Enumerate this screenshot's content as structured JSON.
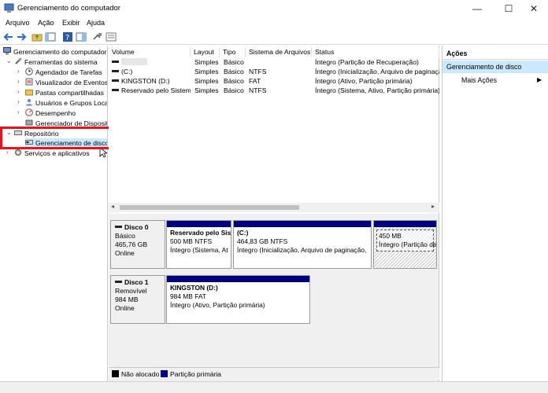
{
  "window": {
    "title": "Gerenciamento do computador",
    "minimize": "—",
    "maximize": "☐",
    "close": "✕"
  },
  "menu": [
    "Arquivo",
    "Ação",
    "Exibir",
    "Ajuda"
  ],
  "tree": {
    "root": "Gerenciamento do computador",
    "system_tools": "Ferramentas do sistema",
    "task_scheduler": "Agendador de Tarefas",
    "event_viewer": "Visualizador de Eventos",
    "shared_folders": "Pastas compartilhadas",
    "users_groups": "Usuários e Grupos Loca",
    "performance": "Desempenho",
    "device_manager": "Gerenciador de Disposit",
    "storage": "Repositório",
    "disk_management": "Gerenciamento de disco",
    "services_apps": "Serviços e aplicativos"
  },
  "columns": [
    "Volume",
    "Layout",
    "Tipo",
    "Sistema de Arquivos",
    "Status"
  ],
  "volumes": [
    {
      "volume": "",
      "layout": "Simples",
      "type": "Básico",
      "fs": "",
      "status": "Íntegro (Partição de Recuperação)"
    },
    {
      "volume": "(C:)",
      "layout": "Simples",
      "type": "Básico",
      "fs": "NTFS",
      "status": "Íntegro (Inicialização, Arquivo de paginaçã"
    },
    {
      "volume": "KINGSTON (D:)",
      "layout": "Simples",
      "type": "Básico",
      "fs": "FAT",
      "status": "Íntegro (Ativo, Partição primária)"
    },
    {
      "volume": "Reservado pelo Sistema",
      "layout": "Simples",
      "type": "Básico",
      "fs": "NTFS",
      "status": "Íntegro (Sistema, Ativo, Partição primária)"
    }
  ],
  "disks": [
    {
      "name": "Disco 0",
      "type": "Básico",
      "size": "465,76 GB",
      "state": "Online",
      "partitions": [
        {
          "title": "Reservado pelo Sis",
          "size": "500 MB NTFS",
          "status": "Íntegro (Sistema, At"
        },
        {
          "title": "(C:)",
          "size": "464,83 GB NTFS",
          "status": "Íntegro (Inicialização, Arquivo de paginação,"
        },
        {
          "title": "",
          "size": "450 MB",
          "status": "Íntegro (Partição de"
        }
      ]
    },
    {
      "name": "Disco 1",
      "type": "Removível",
      "size": "984 MB",
      "state": "Online",
      "partitions": [
        {
          "title": "KINGSTON  (D:)",
          "size": "984 MB FAT",
          "status": "Íntegro (Ativo, Partição primária)"
        }
      ]
    }
  ],
  "legend": {
    "unallocated": "Não alocado",
    "primary": "Partição primária",
    "unallocated_color": "#000000",
    "primary_color": "#00007f"
  },
  "actions": {
    "header": "Ações",
    "section": "Gerenciamento de disco",
    "more": "Mais Ações"
  },
  "colors": {
    "highlight": "#e8131e",
    "selected": "#cce8ff",
    "partition_bar": "#00007f"
  }
}
